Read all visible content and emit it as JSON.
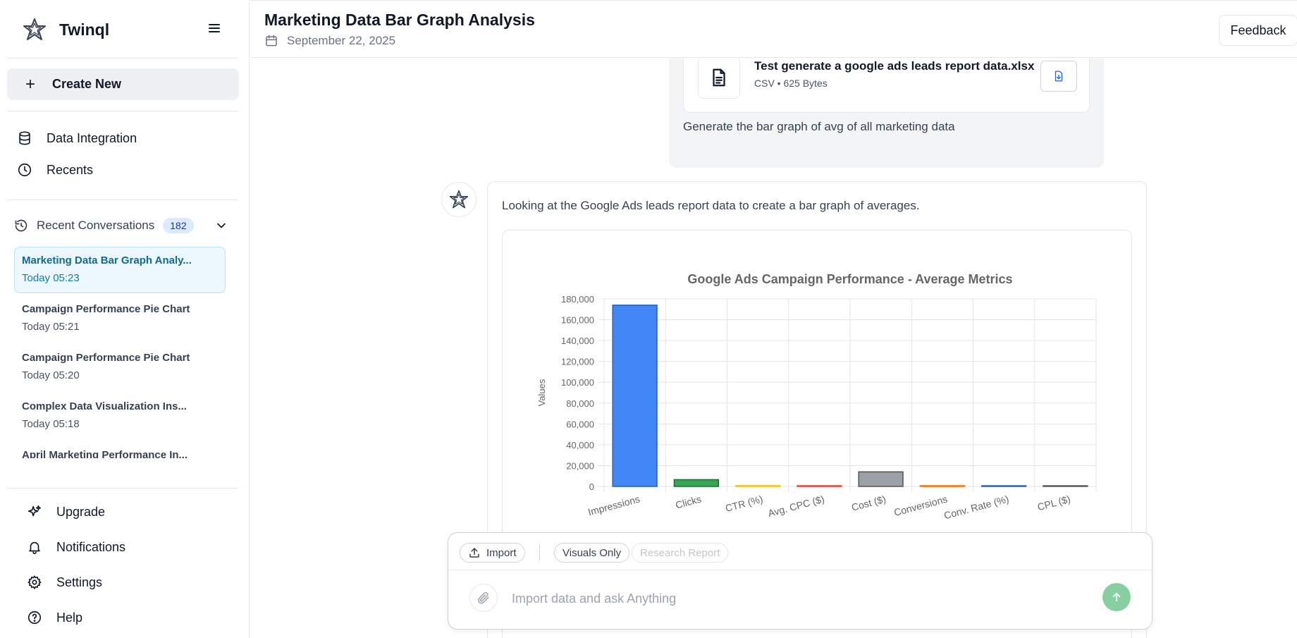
{
  "app": {
    "name": "Twinql",
    "logo_icon": "star-logo-icon"
  },
  "sidebar": {
    "create_new": "Create New",
    "nav": [
      {
        "label": "Data Integration",
        "icon": "database-icon"
      },
      {
        "label": "Recents",
        "icon": "clock-icon"
      }
    ],
    "recent": {
      "label": "Recent Conversations",
      "count": "182",
      "items": [
        {
          "title": "Marketing Data Bar Graph Analy...",
          "time": "Today 05:23",
          "active": true
        },
        {
          "title": "Campaign Performance Pie Chart",
          "time": "Today 05:21"
        },
        {
          "title": "Campaign Performance Pie Chart",
          "time": "Today 05:20"
        },
        {
          "title": "Complex Data Visualization Ins...",
          "time": "Today 05:18"
        },
        {
          "title": "April Marketing Performance In...",
          "time": ""
        }
      ]
    },
    "bottom": [
      {
        "label": "Upgrade",
        "icon": "sparkle-icon"
      },
      {
        "label": "Notifications",
        "icon": "bell-icon"
      },
      {
        "label": "Settings",
        "icon": "gear-icon"
      },
      {
        "label": "Help",
        "icon": "help-circle-icon"
      }
    ]
  },
  "header": {
    "title": "Marketing Data Bar Graph Analysis",
    "date": "September 22, 2025",
    "feedback": "Feedback"
  },
  "conversation": {
    "user": {
      "file_name": "Test generate a google ads leads report data.xlsx",
      "file_meta": "CSV • 625 Bytes",
      "text": "Generate the bar graph of avg of all marketing data"
    },
    "assistant": {
      "text": "Looking at the Google Ads leads report data to create a bar graph of averages."
    }
  },
  "chart_data": {
    "type": "bar",
    "title": "Google Ads Campaign Performance - Average Metrics",
    "xlabel": "",
    "ylabel": "Values",
    "ylim": [
      0,
      180000
    ],
    "yticks": [
      0,
      20000,
      40000,
      60000,
      80000,
      100000,
      120000,
      140000,
      160000,
      180000
    ],
    "grid": true,
    "categories": [
      "Impressions",
      "Clicks",
      "CTR (%)",
      "Avg. CPC ($)",
      "Cost ($)",
      "Conversions",
      "Conv. Rate (%)",
      "CPL ($)"
    ],
    "values": [
      174000,
      6500,
      4,
      2,
      14000,
      200,
      6,
      70
    ],
    "colors": [
      "#4285f4",
      "#34a853",
      "#fbbc05",
      "#ea4335",
      "#9aa0a6",
      "#ff6d01",
      "#4285f4",
      "#9aa0a6"
    ]
  },
  "composer": {
    "import": "Import",
    "visuals_only": "Visuals Only",
    "research_report": "Research Report",
    "placeholder": "Import data and ask Anything"
  }
}
